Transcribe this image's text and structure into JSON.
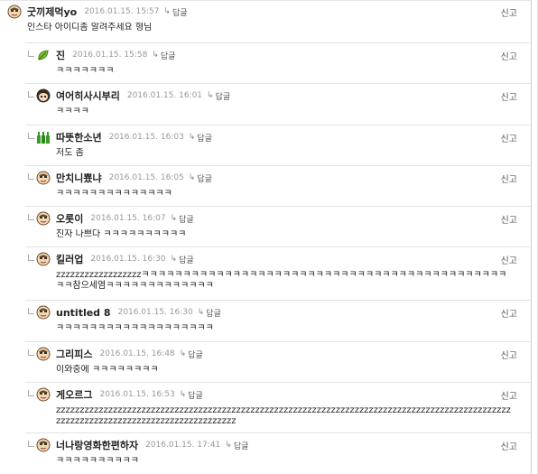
{
  "labels": {
    "report": "신고",
    "reply": "답글"
  },
  "comments": [
    {
      "avatar": "face-icon",
      "nick": "굿끼제먹yo",
      "date": "2016.01.15. 15:57",
      "text": "인스타 아이디좀 알려주세요 형님"
    },
    {
      "avatar": "leaf-icon",
      "nick": "진",
      "date": "2016.01.15. 15:58",
      "text": "ㅋㅋㅋㅋㅋㅋㅋ"
    },
    {
      "avatar": "girl-icon",
      "nick": "여어히사시부리",
      "date": "2016.01.15. 16:01",
      "text": "ㅋㅋㅋㅋ"
    },
    {
      "avatar": "bottles-icon",
      "nick": "따뜻한소년",
      "date": "2016.01.15. 16:03",
      "text": "저도 좀"
    },
    {
      "avatar": "face-icon",
      "nick": "만치니뿄냐",
      "date": "2016.01.15. 16:05",
      "text": "ㅋㅋㅋㅋㅋㅋㅋㅋㅋㅋㅋㅋㅋㅋ"
    },
    {
      "avatar": "face-icon",
      "nick": "오롯이",
      "date": "2016.01.15. 16:07",
      "text": "진자 나쁘다 ㅋㅋㅋㅋㅋㅋㅋㅋㅋㅋ"
    },
    {
      "avatar": "face-icon",
      "nick": "킬러업",
      "date": "2016.01.15. 16:30",
      "text": "zzzzzzzzzzzzzzzzzzㅋㅋㅋㅋㅋㅋㅋㅋㅋㅋㅋㅋㅋㅋㅋㅋㅋㅋㅋㅋㅋㅋㅋㅋㅋㅋㅋㅋㅋㅋㅋㅋㅋㅋㅋㅋㅋㅋㅋㅋㅋㅋㅋㅋㅋㅋ참으세염ㅋㅋㅋㅋㅋㅋㅋㅋㅋㅋㅋㅋㅋ"
    },
    {
      "avatar": "face-icon",
      "nick": "untitled 8",
      "date": "2016.01.15. 16:30",
      "text": "ㅋㅋㅋㅋㅋㅋㅋㅋㅋㅋㅋㅋㅋㅋㅋㅋㅋㅋㅋ"
    },
    {
      "avatar": "face-icon",
      "nick": "그리피스",
      "date": "2016.01.15. 16:48",
      "text": "이와중에 ㅋㅋㅋㅋㅋㅋㅋㅋ"
    },
    {
      "avatar": "face-icon",
      "nick": "게오르그",
      "date": "2016.01.15. 16:53",
      "text": "zzzzzzzzzzzzzzzzzzzzzzzzzzzzzzzzzzzzzzzzzzzzzzzzzzzzzzzzzzzzzzzzzzzzzzzzzzzzzzzzzzzzzzzzzzzzzzzzzzzzzzzzzzzzzzzzzzzzzzzzzzzzzzzzzzzzzz"
    },
    {
      "avatar": "face-icon",
      "nick": "너나랑영화한편하자",
      "date": "2016.01.15. 17:41",
      "text": "ㅋㅋㅋㅋㅋㅋㅋㅋㅋㅋ"
    }
  ]
}
